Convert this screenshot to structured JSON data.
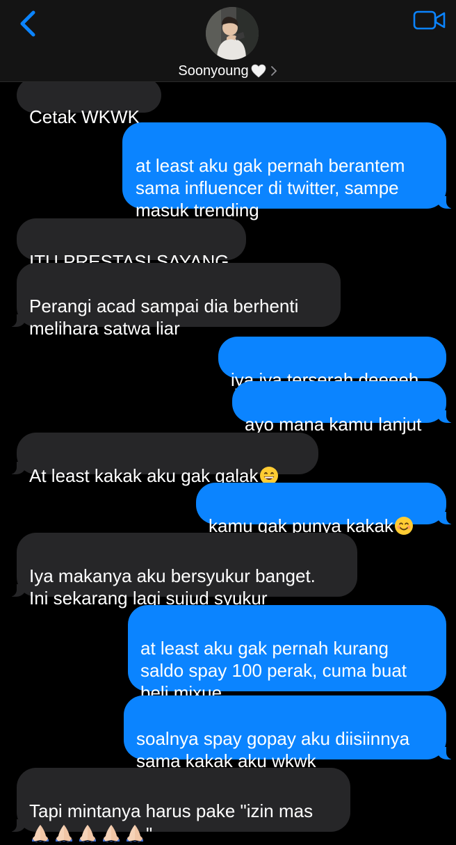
{
  "header": {
    "contact_name": "Soonyoung",
    "back_icon": "chevron-left-icon",
    "video_icon": "video-camera-icon",
    "name_suffix_icon": "white-heart-icon",
    "chevron_icon": "chevron-right-icon",
    "accent": "#0b84ff"
  },
  "messages": [
    {
      "from": "them",
      "text": "Cetak WKWK"
    },
    {
      "from": "me",
      "text": "at least aku gak pernah berantem\nsama influencer di twitter, sampe\nmasuk trending"
    },
    {
      "from": "them",
      "text": "ITU PRESTASI SAYANG"
    },
    {
      "from": "them",
      "text": "Perangi acad sampai dia berhenti\nmelihara satwa liar"
    },
    {
      "from": "me",
      "text": "iya iya terserah deeeeh"
    },
    {
      "from": "me",
      "text": "ayo mana kamu lanjut"
    },
    {
      "from": "them",
      "text": "At least kakak aku gak galak",
      "emoji": "grinning-face-emoji"
    },
    {
      "from": "me",
      "text": "kamu gak punya kakak",
      "emoji": "smiling-face-emoji"
    },
    {
      "from": "them",
      "text": "Iya makanya aku bersyukur banget.\nIni sekarang lagi sujud syukur"
    },
    {
      "from": "me",
      "text": "at least aku gak pernah kurang\nsaldo spay 100 perak, cuma buat\nbeli mixue"
    },
    {
      "from": "me",
      "text": "soalnya spay gopay aku diisiinnya\nsama kakak aku wkwk"
    },
    {
      "from": "them",
      "text": "Tapi mintanya harus pake \"izin mas",
      "text_end": "\"",
      "emoji": "folded-hands-emoji",
      "emoji_count": 5
    }
  ],
  "colors": {
    "incoming_bubble": "#262628",
    "outgoing_bubble": "#0b84ff",
    "background": "#000000"
  }
}
